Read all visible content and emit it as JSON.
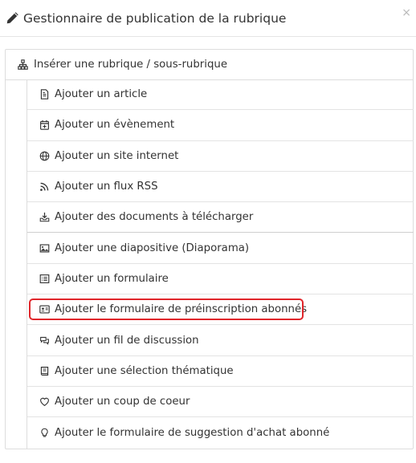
{
  "header": {
    "title": "Gestionnaire de publication de la rubrique",
    "close_label": "×",
    "icon": "pencil-icon"
  },
  "panel": {
    "top_label": "Insérer une rubrique / sous-rubrique",
    "top_icon": "sitemap-icon"
  },
  "items": [
    {
      "label": "Ajouter un article",
      "icon": "document-icon"
    },
    {
      "label": "Ajouter un évènement",
      "icon": "calendar-plus-icon"
    },
    {
      "label": "Ajouter un site internet",
      "icon": "globe-icon"
    },
    {
      "label": "Ajouter un flux RSS",
      "icon": "rss-icon"
    },
    {
      "label": "Ajouter des documents à télécharger",
      "icon": "download-icon"
    },
    {
      "label": "Ajouter une diapositive (Diaporama)",
      "icon": "image-icon"
    },
    {
      "label": "Ajouter un formulaire",
      "icon": "list-form-icon"
    },
    {
      "label": "Ajouter le formulaire de préinscription abonnés",
      "icon": "id-card-icon",
      "highlighted": true
    },
    {
      "label": "Ajouter un fil de discussion",
      "icon": "comments-icon"
    },
    {
      "label": "Ajouter une sélection thématique",
      "icon": "book-icon"
    },
    {
      "label": "Ajouter un coup de coeur",
      "icon": "heart-icon"
    },
    {
      "label": "Ajouter le formulaire de suggestion d'achat abonné",
      "icon": "lightbulb-icon"
    }
  ],
  "colors": {
    "highlight": "#e0262b",
    "border": "#dddddd",
    "text": "#333333"
  }
}
